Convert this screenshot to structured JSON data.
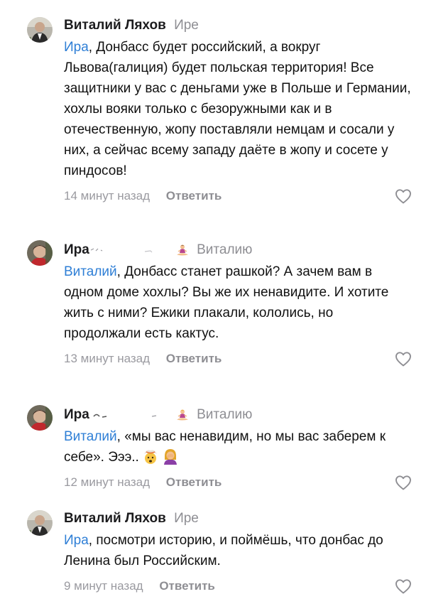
{
  "comments": [
    {
      "author": "Виталий Ляхов",
      "reply_to": "Ире",
      "mention": "Ира",
      "text": ", Донбасс будет российский, а вокруг Львова(галиция) будет польская территория! Все защитники у вас с деньгами уже в Польше и Германии, хохлы вояки только с безоружными как и в отечественную, жопу поставляли немцам и сосали у них, а сейчас всему западу даёте в жопу и сосете у пиндосов!",
      "time": "14 минут назад",
      "reply_label": "Ответить"
    },
    {
      "author": "Ира",
      "reply_to": "Виталию",
      "mention": "Виталий",
      "text": ", Донбасс станет рашкой? А зачем вам в одном доме хохлы? Вы же их ненавидите. И хотите жить с ними? Ежики плакали, кололись, но продолжали есть кактус.",
      "time": "13 минут назад",
      "reply_label": "Ответить"
    },
    {
      "author": "Ира",
      "reply_to": "Виталию",
      "mention": "Виталий",
      "text": ", «мы вас ненавидим, но мы вас заберем к себе». Эээ..",
      "time": "12 минут назад",
      "reply_label": "Ответить"
    },
    {
      "author": "Виталий Ляхов",
      "reply_to": "Ире",
      "mention": "Ира",
      "text": ", посмотри историю, и поймёшь, что донбас до Ленина был Российским.",
      "time": "9 минут назад",
      "reply_label": "Ответить"
    }
  ],
  "colors": {
    "mention": "#2f7fd6",
    "secondary": "#8e8e93"
  },
  "icons": {
    "like": "heart-outline-icon",
    "emoji_meditation": "person-in-lotus-position-emoji",
    "emoji_exploding_head": "exploding-head-emoji",
    "emoji_facepalm": "woman-facepalming-emoji"
  }
}
